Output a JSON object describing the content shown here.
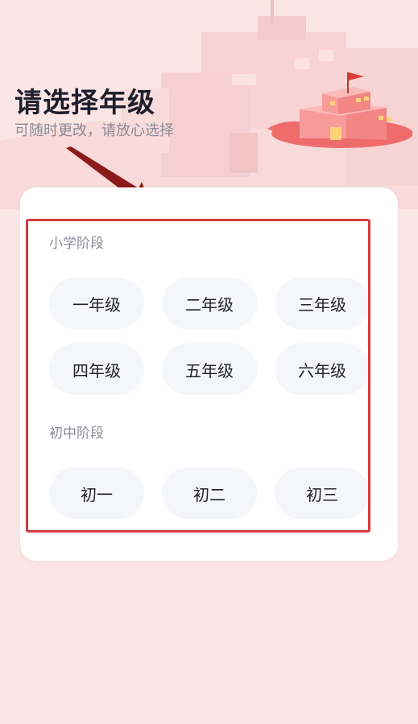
{
  "header": {
    "title": "请选择年级",
    "subtitle": "可随时更改，请放心选择"
  },
  "sections": [
    {
      "label": "小学阶段",
      "grades": [
        "一年级",
        "二年级",
        "三年级",
        "四年级",
        "五年级",
        "六年级"
      ]
    },
    {
      "label": "初中阶段",
      "grades": [
        "初一",
        "初二",
        "初三"
      ]
    }
  ],
  "colors": {
    "background": "#fbe6e6",
    "highlight_border": "#d83b3b",
    "button_bg": "#f5f6fa",
    "arrow": "#8b1a1a",
    "school_accent": "#f06b6b"
  },
  "icons": {
    "school": "school-building-icon",
    "arrow": "pointer-arrow-icon"
  }
}
